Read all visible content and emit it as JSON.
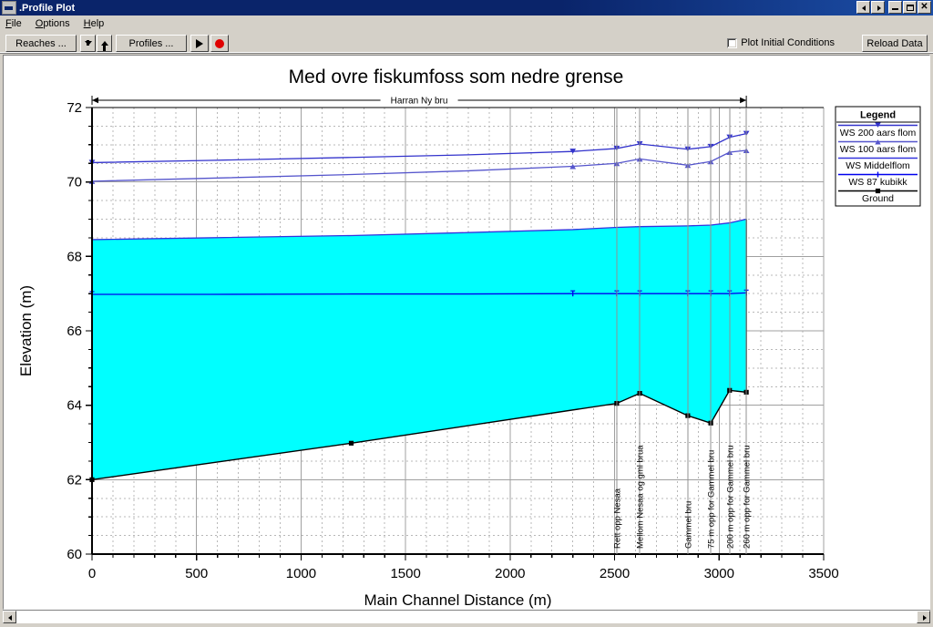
{
  "window": {
    "title": ".Profile Plot",
    "icon": "window-icon",
    "controls": [
      {
        "name": "mdi-prev",
        "glyph": "◄"
      },
      {
        "name": "mdi-next",
        "glyph": "►"
      },
      {
        "name": "minimize",
        "glyph": "_"
      },
      {
        "name": "maximize",
        "glyph": "□"
      },
      {
        "name": "close",
        "glyph": "✕"
      }
    ]
  },
  "menu": {
    "items": [
      {
        "label": "File",
        "accel": "F"
      },
      {
        "label": "Options",
        "accel": "O"
      },
      {
        "label": "Help",
        "accel": "H"
      }
    ]
  },
  "toolbar": {
    "reaches_label": "Reaches ...",
    "profiles_label": "Profiles ...",
    "down_arrow": "down-arrow-icon",
    "up_arrow": "up-arrow-icon",
    "play_icon": "play-icon",
    "record_icon": "record-icon",
    "plot_initial_conditions_label": "Plot Initial Conditions",
    "plot_initial_conditions_checked": false,
    "reload_label": "Reload Data"
  },
  "colors": {
    "ws_200": "#3333cc",
    "ws_100": "#5555cc",
    "ws_middelflom": "#3333dd",
    "ws_87": "#0000ee",
    "ground": "#000000",
    "water_fill": "#00ffff",
    "grid_major": "#a0a0a0",
    "grid_minor": "#b8b8b8",
    "accent": "#0a246a"
  },
  "chart_data": {
    "type": "line",
    "title": "Med ovre fiskumfoss som nedre grense",
    "reach_label": "Harran Ny bru",
    "xlabel": "Main Channel Distance (m)",
    "ylabel": "Elevation (m)",
    "xlim": [
      0,
      3500
    ],
    "ylim": [
      60,
      72
    ],
    "xticks": [
      0,
      500,
      1000,
      1500,
      2000,
      2500,
      3000,
      3500
    ],
    "yticks": [
      60,
      62,
      64,
      66,
      68,
      70,
      72
    ],
    "xminor_step": 100,
    "yminor_step": 0.5,
    "grid": true,
    "legend_position": "right-top",
    "legend_title": "Legend",
    "series": [
      {
        "name": "WS  200 aars flom",
        "color": "#3333cc",
        "marker": "triangle-down",
        "x": [
          0,
          560,
          1240,
          1800,
          2300,
          2510,
          2620,
          2850,
          2960,
          3050,
          3130
        ],
        "y": [
          70.52,
          70.58,
          70.66,
          70.73,
          70.82,
          70.9,
          71.02,
          70.88,
          70.95,
          71.2,
          71.3
        ]
      },
      {
        "name": "WS  100 aars flom",
        "color": "#5555cc",
        "marker": "triangle-up",
        "x": [
          0,
          560,
          1240,
          1800,
          2300,
          2510,
          2620,
          2850,
          2960,
          3050,
          3130
        ],
        "y": [
          70.02,
          70.1,
          70.2,
          70.3,
          70.42,
          70.5,
          70.62,
          70.45,
          70.55,
          70.8,
          70.85
        ]
      },
      {
        "name": "WS  Middelflom",
        "color": "#3333dd",
        "marker": "none",
        "x": [
          0,
          560,
          1240,
          1800,
          2300,
          2510,
          2620,
          2850,
          2960,
          3050,
          3130
        ],
        "y": [
          68.45,
          68.5,
          68.56,
          68.64,
          68.72,
          68.78,
          68.8,
          68.82,
          68.84,
          68.9,
          69.0
        ]
      },
      {
        "name": "WS  87 kubikk",
        "color": "#0000ee",
        "marker": "tick",
        "x": [
          0,
          560,
          1240,
          1800,
          2300,
          2510,
          2620,
          2850,
          2960,
          3050,
          3130
        ],
        "y": [
          66.98,
          66.98,
          66.99,
          66.99,
          67.0,
          67.0,
          67.0,
          67.0,
          67.0,
          67.0,
          67.02
        ]
      },
      {
        "name": "Ground",
        "color": "#000000",
        "marker": "square",
        "x": [
          0,
          1240,
          2510,
          2620,
          2850,
          2960,
          3050,
          3130
        ],
        "y": [
          62.0,
          62.98,
          64.05,
          64.32,
          63.72,
          63.52,
          64.4,
          64.35
        ]
      }
    ],
    "station_labels": [
      {
        "x": 2510,
        "label": "Rett opp Nesaa"
      },
      {
        "x": 2620,
        "label": "Mellom Nesaa og gml brua"
      },
      {
        "x": 2850,
        "label": "Gammel bru"
      },
      {
        "x": 2960,
        "label": "75 m opp for Gammel bru"
      },
      {
        "x": 3050,
        "label": "200 m opp for Gammel bru"
      },
      {
        "x": 3130,
        "label": "260 m opp for Gammel bru"
      }
    ],
    "legend_entries": [
      {
        "label": "WS  200 aars flom",
        "color": "#3333cc",
        "marker": "triangle-down"
      },
      {
        "label": "WS  100 aars flom",
        "color": "#5555cc",
        "marker": "triangle-up"
      },
      {
        "label": "WS  Middelflom",
        "color": "#3333dd",
        "marker": "none"
      },
      {
        "label": "WS  87 kubikk",
        "color": "#0000ee",
        "marker": "tick"
      },
      {
        "label": "Ground",
        "color": "#000000",
        "marker": "square"
      }
    ]
  }
}
